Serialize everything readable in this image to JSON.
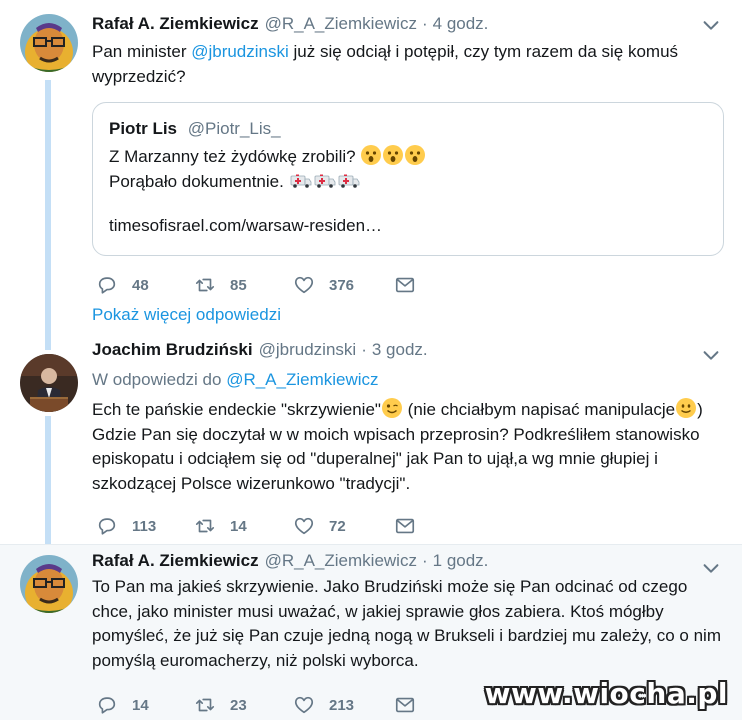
{
  "tweets": [
    {
      "author_name": "Rafał A. Ziemkiewicz",
      "handle": "@R_A_Ziemkiewicz",
      "separator": "·",
      "time": "4 godz.",
      "text_before": "Pan minister ",
      "mention": "@jbrudzinski",
      "text_after": " już się odciął i potępił, czy tym razem da się komuś wyprzedzić?",
      "quote": {
        "author_name": "Piotr Lis",
        "handle": "@Piotr_Lis_",
        "line1": "Z Marzanny też żydówkę zrobili?",
        "line2": "Porąbało dokumentnie.",
        "link": "timesofisrael.com/warsaw-residen…"
      },
      "replies": "48",
      "retweets": "85",
      "likes": "376"
    },
    {
      "author_name": "Joachim Brudziński",
      "handle": "@jbrudzinski",
      "separator": "·",
      "time": "3 godz.",
      "reply_prefix": "W odpowiedzi do ",
      "reply_to": "@R_A_Ziemkiewicz",
      "text_p1": "Ech te pańskie endeckie \"skrzywienie\"",
      "text_p2": " (nie chciałbym napisać manipulacje",
      "text_p3": ") Gdzie Pan się doczytał w w moich wpisach przeprosin? Podkreśliłem stanowisko episkopatu i odciąłem się od \"duperalnej\" jak Pan to ujął,a wg mnie głupiej i szkodzącej Polsce wizerunkowo \"tradycji\".",
      "replies": "113",
      "retweets": "14",
      "likes": "72"
    },
    {
      "author_name": "Rafał A. Ziemkiewicz",
      "handle": "@R_A_Ziemkiewicz",
      "separator": "·",
      "time": "1 godz.",
      "text": "To Pan ma jakieś skrzywienie. Jako Brudziński może się Pan odcinać od czego chce, jako minister musi uważać, w jakiej sprawie głos zabiera. Ktoś mógłby pomyśleć, że już się Pan czuje jedną nogą w Brukseli i bardziej mu zależy, co o nim pomyślą euromacherzy, niż polski wyborca.",
      "replies": "14",
      "retweets": "23",
      "likes": "213"
    }
  ],
  "show_more": "Pokaż więcej odpowiedzi",
  "watermark": "www.wiocha.pl",
  "colors": {
    "link": "#1b95e0",
    "muted": "#657786",
    "thread_line": "#c4dff6",
    "highlight_bg": "#f5f8fa"
  }
}
